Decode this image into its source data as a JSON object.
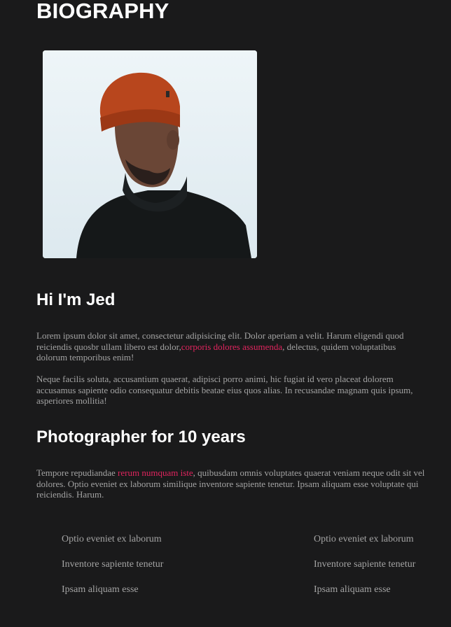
{
  "page": {
    "title": "BIOGRAPHY"
  },
  "portrait": {
    "alt": "Portrait of a man in an orange beanie and black turtleneck"
  },
  "intro": {
    "heading": "Hi I'm Jed",
    "p1_before": "Lorem ipsum dolor sit amet, consectetur adipisicing elit. Dolor aperiam a velit. Harum eligendi quod reiciendis quosbr ullam libero est dolor,",
    "p1_link": "corporis dolores assumenda",
    "p1_after": ", delectus, quidem voluptatibus dolorum temporibus enim!",
    "p2": "Neque facilis soluta, accusantium quaerat, adipisci porro animi, hic fugiat id vero placeat dolorem accusamus sapiente odio consequatur debitis beatae eius quos alias. In recusandae magnam quis ipsum, asperiores mollitia!"
  },
  "experience": {
    "heading": "Photographer for 10 years",
    "p_before": "Tempore repudiandae ",
    "p_link": "rerum numquam iste",
    "p_after": ", quibusdam omnis voluptates quaerat veniam neque odit sit vel dolores. Optio eveniet ex laborum similique inventore sapiente tenetur. Ipsam aliquam esse voluptate qui reiciendis. Harum."
  },
  "lists": {
    "left": [
      "Optio eveniet ex laborum",
      "Inventore sapiente tenetur",
      "Ipsam aliquam esse"
    ],
    "right": [
      "Optio eveniet ex laborum",
      "Inventore sapiente tenetur",
      "Ipsam aliquam esse"
    ]
  },
  "colors": {
    "background": "#1a1a1b",
    "heading": "#ffffff",
    "body_text": "#a3a3a3",
    "accent_link": "#e0245e",
    "beanie": "#b8461d",
    "photo_sky": "#e5eff4"
  }
}
